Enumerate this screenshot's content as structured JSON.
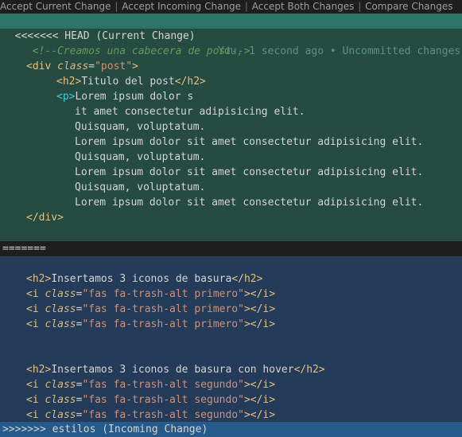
{
  "codelens": {
    "accept_current": "Accept Current Change",
    "accept_incoming": "Accept Incoming Change",
    "accept_both": "Accept Both Changes",
    "compare": "Compare Changes",
    "separator": "|"
  },
  "current": {
    "marker": "<<<<<<< HEAD (Current Change)",
    "ghost_text": "You, 1 second ago • Uncommitted changes",
    "comment": "<!--Creamos una cabecera de post-->",
    "div_open": "<div",
    "div_attr": "class",
    "div_eq": "=",
    "div_value": "\"post\"",
    "div_close_bracket": ">",
    "h2_open": "<h2>",
    "h2_text": "Titulo del post",
    "h2_close": "</h2>",
    "p_open": "<p>",
    "p_lines": [
      "Lorem ipsum dolor s",
      "it amet consectetur adipisicing elit.",
      "Quisquam, voluptatum.",
      "Lorem ipsum dolor sit amet consectetur adipisicing elit.",
      "Quisquam, voluptatum.",
      "Lorem ipsum dolor sit amet consectetur adipisicing elit.",
      "Quisquam, voluptatum.",
      "Lorem ipsum dolor sit amet consectetur adipisicing elit."
    ],
    "div_end": "</div>"
  },
  "divider": "=======",
  "incoming": {
    "h2_first_text": "Insertamos 3 iconos de basura",
    "h2_second_text": "Insertamos 3 iconos de basura con hover",
    "h2_open": "<h2>",
    "h2_close": "</h2>",
    "i_open": "<i",
    "i_attr": "class",
    "i_eq": "=",
    "i_close": "></i>",
    "icon_class_first": "\"fas fa-trash-alt primero\"",
    "icon_class_second": "\"fas fa-trash-alt segundo\"",
    "marker": ">>>>>>> estilos (Incoming Change)"
  }
}
